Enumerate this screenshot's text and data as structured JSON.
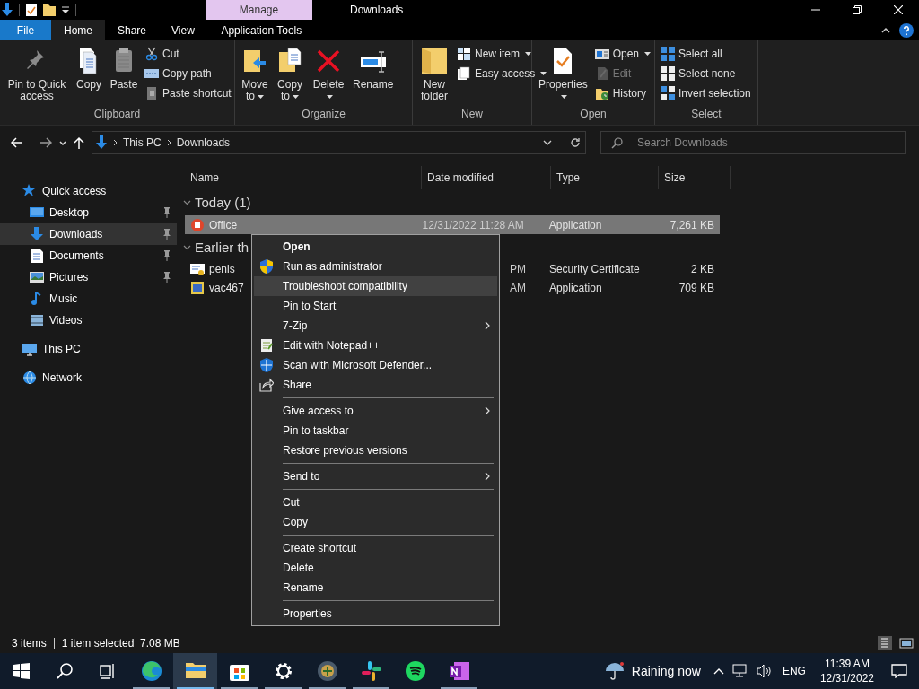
{
  "window": {
    "title": "Downloads",
    "context_tab": "Manage"
  },
  "ribbon_tabs": [
    {
      "label": "File",
      "kind": "file",
      "selected": false
    },
    {
      "label": "Home",
      "kind": "tab",
      "selected": true
    },
    {
      "label": "Share",
      "kind": "tab",
      "selected": false
    },
    {
      "label": "View",
      "kind": "tab",
      "selected": false
    },
    {
      "label": "Application Tools",
      "kind": "context",
      "selected": false
    }
  ],
  "ribbon_groups": [
    {
      "label": "Clipboard",
      "items": [
        {
          "label": "Pin to Quick access",
          "kind": "large",
          "dropdown": false,
          "disabled": false
        },
        {
          "label": "Copy",
          "kind": "large",
          "dropdown": false,
          "disabled": false
        },
        {
          "label": "Paste",
          "kind": "large",
          "dropdown": false,
          "disabled": false
        },
        {
          "label": "Cut",
          "kind": "small",
          "dropdown": false,
          "disabled": false
        },
        {
          "label": "Copy path",
          "kind": "small",
          "dropdown": false,
          "disabled": false
        },
        {
          "label": "Paste shortcut",
          "kind": "small",
          "dropdown": false,
          "disabled": false
        }
      ]
    },
    {
      "label": "Organize",
      "items": [
        {
          "label": "Move to",
          "kind": "large",
          "dropdown": true,
          "disabled": false
        },
        {
          "label": "Copy to",
          "kind": "large",
          "dropdown": true,
          "disabled": false
        },
        {
          "label": "Delete",
          "kind": "large",
          "dropdown": true,
          "disabled": false
        },
        {
          "label": "Rename",
          "kind": "large",
          "dropdown": false,
          "disabled": false
        }
      ]
    },
    {
      "label": "New",
      "items": [
        {
          "label": "New folder",
          "kind": "large",
          "dropdown": false,
          "disabled": false
        },
        {
          "label": "New item",
          "kind": "small",
          "dropdown": true,
          "disabled": false
        },
        {
          "label": "Easy access",
          "kind": "small",
          "dropdown": true,
          "disabled": false
        }
      ]
    },
    {
      "label": "Open",
      "items": [
        {
          "label": "Properties",
          "kind": "large",
          "dropdown": true,
          "disabled": false
        },
        {
          "label": "Open",
          "kind": "small",
          "dropdown": true,
          "disabled": false
        },
        {
          "label": "Edit",
          "kind": "small",
          "dropdown": false,
          "disabled": true
        },
        {
          "label": "History",
          "kind": "small",
          "dropdown": false,
          "disabled": false
        }
      ]
    },
    {
      "label": "Select",
      "items": [
        {
          "label": "Select all",
          "kind": "small",
          "dropdown": false,
          "disabled": false
        },
        {
          "label": "Select none",
          "kind": "small",
          "dropdown": false,
          "disabled": false
        },
        {
          "label": "Invert selection",
          "kind": "small",
          "dropdown": false,
          "disabled": false
        }
      ]
    }
  ],
  "address_bar": {
    "path": [
      "This PC",
      "Downloads"
    ]
  },
  "search": {
    "placeholder": "Search Downloads"
  },
  "sidebar": {
    "items": [
      {
        "label": "Quick access",
        "selected": false,
        "pinned": false,
        "children": [
          {
            "label": "Desktop",
            "selected": false,
            "pinned": true
          },
          {
            "label": "Downloads",
            "selected": true,
            "pinned": true
          },
          {
            "label": "Documents",
            "selected": false,
            "pinned": true
          },
          {
            "label": "Pictures",
            "selected": false,
            "pinned": true
          },
          {
            "label": "Music",
            "selected": false,
            "pinned": false
          },
          {
            "label": "Videos",
            "selected": false,
            "pinned": false
          }
        ]
      },
      {
        "label": "This PC",
        "selected": false,
        "pinned": false
      },
      {
        "label": "Network",
        "selected": false,
        "pinned": false
      }
    ]
  },
  "file_list": {
    "columns": [
      "Name",
      "Date modified",
      "Type",
      "Size"
    ],
    "groups": [
      {
        "label": "Today (1)",
        "rows": [
          {
            "name": "Office",
            "date_modified": "12/31/2022 11:28 AM",
            "type": "Application",
            "size": "7,261 KB",
            "selected": true
          }
        ]
      },
      {
        "label": "Earlier th",
        "rows": [
          {
            "name": "penis",
            "date_modified": "PM",
            "type": "Security Certificate",
            "size": "2 KB",
            "selected": false
          },
          {
            "name": "vac467",
            "date_modified": "AM",
            "type": "Application",
            "size": "709 KB",
            "selected": false
          }
        ]
      }
    ]
  },
  "context_menu": [
    {
      "label": "Open",
      "kind": "item",
      "default": true,
      "selected": false
    },
    {
      "label": "Run as administrator",
      "kind": "item",
      "default": false,
      "selected": false
    },
    {
      "label": "Troubleshoot compatibility",
      "kind": "item",
      "default": false,
      "selected": true
    },
    {
      "label": "Pin to Start",
      "kind": "item",
      "default": false,
      "selected": false
    },
    {
      "label": "7-Zip",
      "kind": "submenu",
      "default": false,
      "selected": false
    },
    {
      "label": "Edit with Notepad++",
      "kind": "item",
      "default": false,
      "selected": false
    },
    {
      "label": "Scan with Microsoft Defender...",
      "kind": "item",
      "default": false,
      "selected": false
    },
    {
      "label": "Share",
      "kind": "item",
      "default": false,
      "selected": false
    },
    {
      "kind": "separator"
    },
    {
      "label": "Give access to",
      "kind": "submenu",
      "default": false,
      "selected": false
    },
    {
      "label": "Pin to taskbar",
      "kind": "item",
      "default": false,
      "selected": false
    },
    {
      "label": "Restore previous versions",
      "kind": "item",
      "default": false,
      "selected": false
    },
    {
      "kind": "separator"
    },
    {
      "label": "Send to",
      "kind": "submenu",
      "default": false,
      "selected": false
    },
    {
      "kind": "separator"
    },
    {
      "label": "Cut",
      "kind": "item",
      "default": false,
      "selected": false
    },
    {
      "label": "Copy",
      "kind": "item",
      "default": false,
      "selected": false
    },
    {
      "kind": "separator"
    },
    {
      "label": "Create shortcut",
      "kind": "item",
      "default": false,
      "selected": false
    },
    {
      "label": "Delete",
      "kind": "item",
      "default": false,
      "selected": false
    },
    {
      "label": "Rename",
      "kind": "item",
      "default": false,
      "selected": false
    },
    {
      "kind": "separator"
    },
    {
      "label": "Properties",
      "kind": "item",
      "default": false,
      "selected": false
    }
  ],
  "status_bar": {
    "item_count": "3 items",
    "selection": "1 item selected  7.08 MB"
  },
  "taskbar": {
    "apps": [
      {
        "selected": false,
        "running": false
      },
      {
        "selected": false,
        "running": false
      },
      {
        "selected": false,
        "running": false
      },
      {
        "selected": false,
        "running": true
      },
      {
        "selected": true,
        "running": true
      },
      {
        "selected": false,
        "running": true
      },
      {
        "selected": false,
        "running": true
      },
      {
        "selected": false,
        "running": true
      },
      {
        "selected": false,
        "running": true
      },
      {
        "selected": false,
        "running": false
      },
      {
        "selected": false,
        "running": true
      }
    ],
    "weather": "Raining now",
    "language": "ENG",
    "time": "11:39 AM",
    "date": "12/31/2022"
  }
}
